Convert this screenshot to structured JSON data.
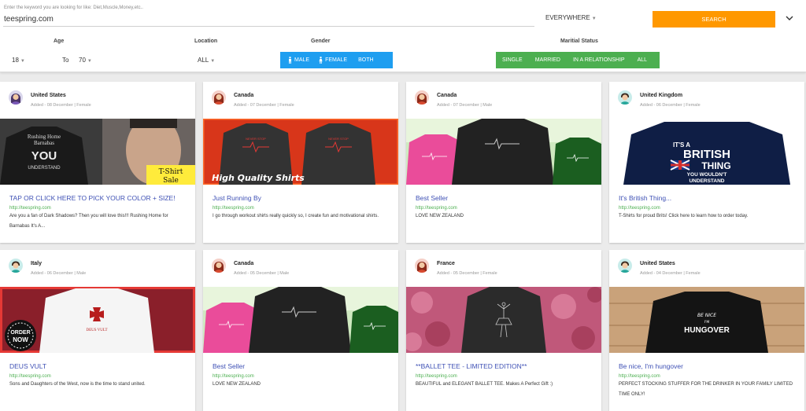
{
  "search": {
    "hint": "Enter the keyword you are looking for like: Diet,Muscle,Money,etc..",
    "value": "teespring.com",
    "scope": "EVERYWHERE",
    "button_label": "SEARCH"
  },
  "filters": {
    "age_label": "Age",
    "age_from": "18",
    "to_label": "To",
    "age_to": "70",
    "location_label": "Location",
    "location_value": "ALL",
    "gender_label": "Gender",
    "gender_options": [
      "MALE",
      "FEMALE",
      "BOTH"
    ],
    "status_label": "Maritial Status",
    "status_options": [
      "SINGLE",
      "MARRIED",
      "IN A RELATIONSHIP",
      "ALL"
    ]
  },
  "colors": {
    "accent_orange": "#ff9800",
    "gender_blue": "#1e9ef0",
    "status_green": "#4caf50",
    "title_blue": "#3f51b5"
  },
  "cards": [
    {
      "country": "United States",
      "meta": "Added - 08 December | Female",
      "avatar": "female-avatar",
      "image": "dark-shadows-shirt",
      "title": "TAP OR CLICK HERE TO PICK YOUR COLOR + SIZE!",
      "url": "http://teespring.com",
      "desc": "Are you a fan of Dark Shadows? Then you will love this!!! Rushing Home for Barnabas It's A...",
      "img_text": [
        "Rushing Home",
        "Barnabas",
        "YOU",
        "UNDERSTAND",
        "T-Shirt",
        "Sale"
      ]
    },
    {
      "country": "Canada",
      "meta": "Added - 07 December | Female",
      "avatar": "female-avatar",
      "image": "running-shirts",
      "title": "Just Running By",
      "url": "http://teespring.com",
      "desc": "I go through workout shirts really quickly so, I create fun and motivational shirts.",
      "img_text": [
        "High Quality Shirts",
        "NEVER STOP"
      ]
    },
    {
      "country": "Canada",
      "meta": "Added - 07 December | Male",
      "avatar": "female-avatar",
      "image": "nz-fern-shirts",
      "title": "Best Seller",
      "url": "http://teespring.com",
      "desc": "LOVE NEW ZEALAND",
      "img_text": []
    },
    {
      "country": "United Kingdom",
      "meta": "Added - 06 December | Female",
      "avatar": "male-avatar",
      "image": "british-thing-shirt",
      "title": "It's British Thing...",
      "url": "http://teespring.com",
      "desc": "T-Shirts for proud Brits! Click here to learn how to order today.",
      "img_text": [
        "IT'S A",
        "BRITISH",
        "THING",
        "YOU WOULDN'T",
        "UNDERSTAND"
      ]
    },
    {
      "country": "Italy",
      "meta": "Added - 06 December | Male",
      "avatar": "male-avatar",
      "image": "deus-vult-shirt",
      "title": "DEUS VULT",
      "url": "http://teespring.com",
      "desc": "Sons and Daughters of the West, now is the time to stand united.",
      "img_text": [
        "DEUS VULT",
        "ORDER",
        "NOW"
      ]
    },
    {
      "country": "Canada",
      "meta": "Added - 05 December | Male",
      "avatar": "female-avatar",
      "image": "nz-fern-shirts",
      "title": "Best Seller",
      "url": "http://teespring.com",
      "desc": "LOVE NEW ZEALAND",
      "img_text": []
    },
    {
      "country": "France",
      "meta": "Added - 05 December | Female",
      "avatar": "female-avatar",
      "image": "ballet-tee",
      "title": "**BALLET TEE - LIMITED EDITION**",
      "url": "http://teespring.com",
      "desc": "BEAUTIFUL and ELEGANT BALLET TEE. Makes A Perfect Gift :)",
      "img_text": []
    },
    {
      "country": "United States",
      "meta": "Added - 04 December | Female",
      "avatar": "male-avatar",
      "image": "hungover-shirt",
      "title": "Be nice, I'm hungover",
      "url": "http://teespring.com",
      "desc": "PERFECT STOCKING STUFFER FOR THE DRINKER IN YOUR FAMILY LIMITED TIME ONLY!",
      "img_text": [
        "BE NICE",
        "I'M",
        "HUNGOVER"
      ]
    }
  ]
}
